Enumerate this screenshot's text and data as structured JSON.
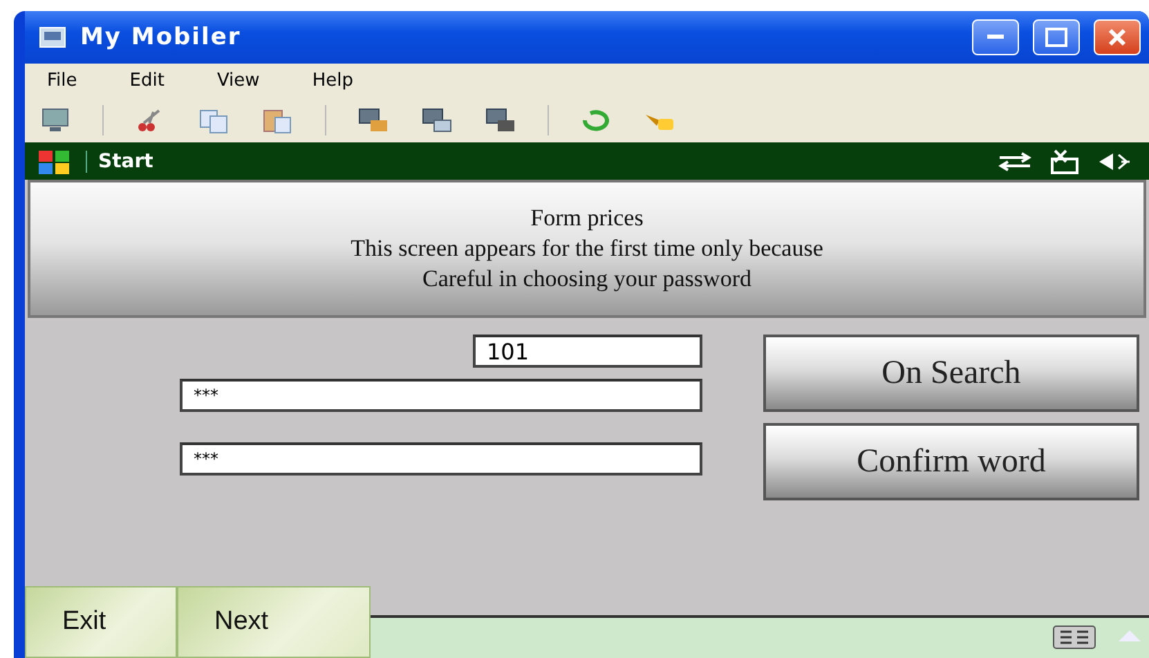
{
  "window": {
    "title": "My Mobiler"
  },
  "menu": [
    "File",
    "Edit",
    "View",
    "Help"
  ],
  "start_bar": {
    "label": "Start"
  },
  "header": {
    "lines": [
      "Form prices",
      "This screen appears for the first time only because",
      "Careful in choosing your password"
    ]
  },
  "fields": [
    {
      "kind": "short",
      "value": "101"
    },
    {
      "kind": "wide",
      "value": "***"
    },
    {
      "kind": "wide",
      "value": "***"
    }
  ],
  "buttons": [
    "On Search",
    "Confirm word"
  ],
  "softkeys": [
    "Exit",
    "Next"
  ]
}
